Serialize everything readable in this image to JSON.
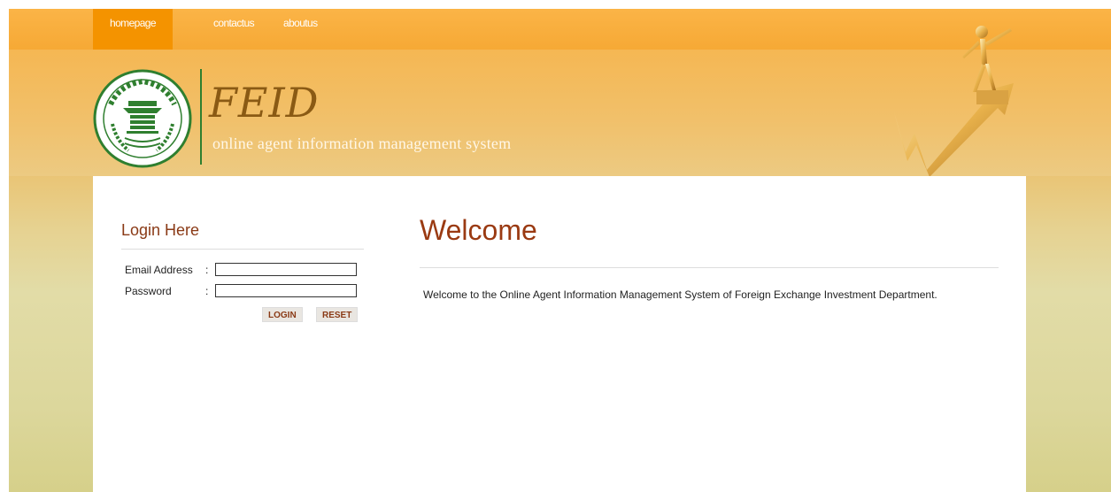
{
  "nav": {
    "items": [
      {
        "label": "homepage",
        "active": true
      },
      {
        "label": "contactus",
        "active": false
      },
      {
        "label": "aboutus",
        "active": false
      }
    ]
  },
  "header": {
    "title": "FEID",
    "subtitle": "online agent information management system",
    "logo_icon": "bangladesh-bank-seal-icon",
    "figure_icon": "person-on-rising-arrow-icon"
  },
  "login": {
    "title": "Login Here",
    "email_label": "Email Address",
    "password_label": "Password",
    "colon": ":",
    "email_value": "",
    "password_value": "",
    "login_button": "LOGIN",
    "reset_button": "RESET"
  },
  "main": {
    "title": "Welcome",
    "text": "Welcome to the Online Agent Information Management System of Foreign Exchange Investment Department."
  },
  "colors": {
    "accent_orange": "#f49300",
    "title_brown": "#9a3a12",
    "brand_green": "#2f7f2f"
  }
}
